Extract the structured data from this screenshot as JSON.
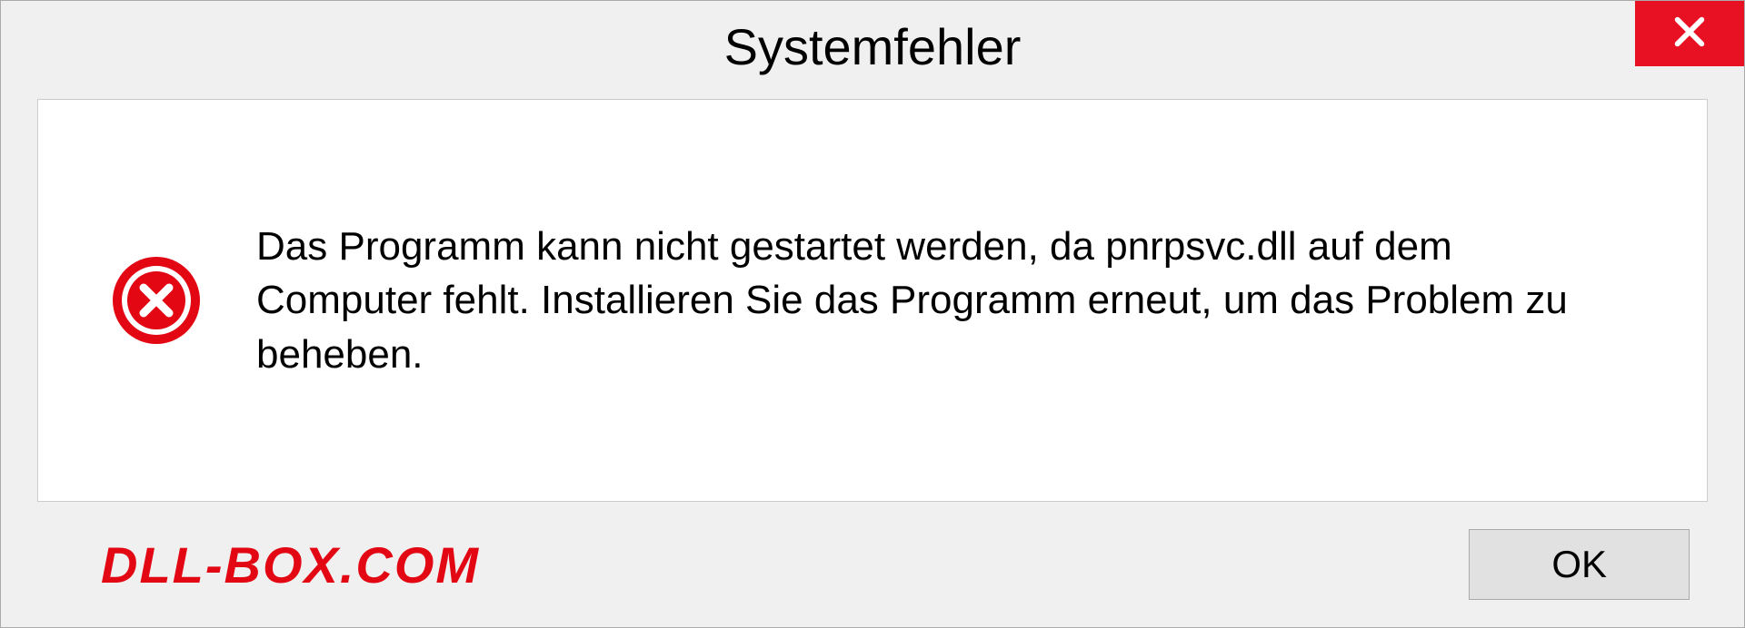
{
  "dialog": {
    "title": "Systemfehler",
    "message": "Das Programm kann nicht gestartet werden, da pnrpsvc.dll auf dem Computer fehlt. Installieren Sie das Programm erneut, um das Problem zu beheben.",
    "ok_label": "OK"
  },
  "watermark": "DLL-BOX.COM"
}
